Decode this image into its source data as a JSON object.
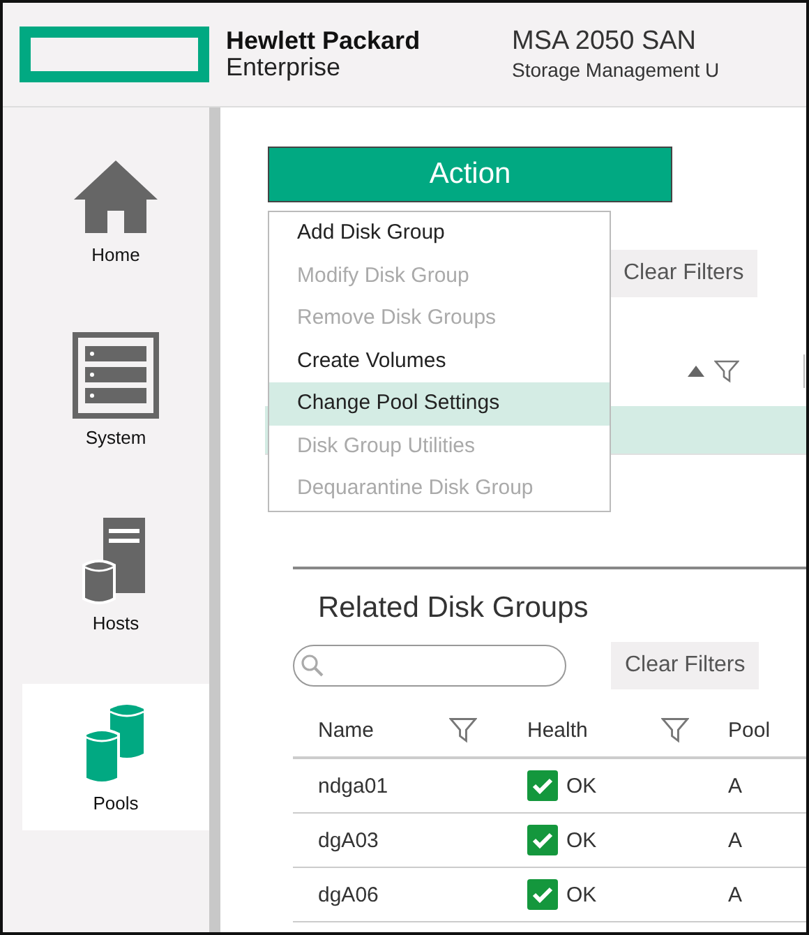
{
  "header": {
    "brand_line1": "Hewlett Packard",
    "brand_line2": "Enterprise",
    "product": "MSA 2050 SAN",
    "subtitle": "Storage Management U"
  },
  "sidebar": {
    "items": [
      {
        "label": "Home",
        "kind": "home",
        "selected": false
      },
      {
        "label": "System",
        "kind": "system",
        "selected": false
      },
      {
        "label": "Hosts",
        "kind": "hosts",
        "selected": false
      },
      {
        "label": "Pools",
        "kind": "pools",
        "selected": true
      }
    ]
  },
  "pools_table": {
    "clear_filters": "Clear Filters",
    "rows": [
      {
        "selected": true
      }
    ]
  },
  "action_menu": {
    "button": "Action",
    "items": [
      {
        "label": "Add Disk Group",
        "disabled": false,
        "selected": false
      },
      {
        "label": "Modify Disk Group",
        "disabled": true,
        "selected": false
      },
      {
        "label": "Remove Disk Groups",
        "disabled": true,
        "selected": false
      },
      {
        "label": "Create Volumes",
        "disabled": false,
        "selected": false
      },
      {
        "label": "Change Pool Settings",
        "disabled": false,
        "selected": true
      },
      {
        "label": "Disk Group Utilities",
        "disabled": true,
        "selected": false
      },
      {
        "label": "Dequarantine Disk Group",
        "disabled": true,
        "selected": false
      }
    ]
  },
  "related": {
    "title": "Related Disk Groups",
    "clear_filters": "Clear Filters",
    "columns": [
      {
        "label": "Name",
        "filter": true
      },
      {
        "label": "Health",
        "filter": true
      },
      {
        "label": "Pool",
        "filter": false
      }
    ],
    "rows": [
      {
        "name": "ndga01",
        "health": "OK",
        "pool": "A"
      },
      {
        "name": "dgA03",
        "health": "OK",
        "pool": "A"
      },
      {
        "name": "dgA06",
        "health": "OK",
        "pool": "A"
      }
    ]
  }
}
